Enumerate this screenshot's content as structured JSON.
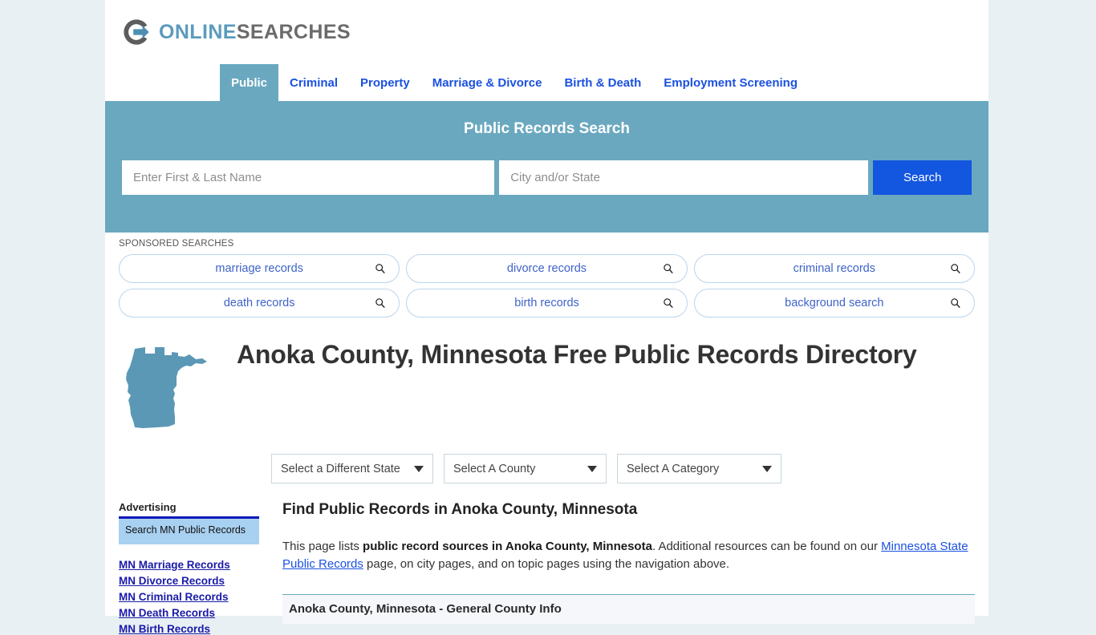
{
  "brand": {
    "name_part1": "ONLINE",
    "name_part2": "SEARCHES",
    "logo_icon": "circle-arrow-logo-icon"
  },
  "nav": {
    "tabs": [
      {
        "label": "Public",
        "active": true
      },
      {
        "label": "Criminal",
        "active": false
      },
      {
        "label": "Property",
        "active": false
      },
      {
        "label": "Marriage & Divorce",
        "active": false
      },
      {
        "label": "Birth & Death",
        "active": false
      },
      {
        "label": "Employment Screening",
        "active": false
      }
    ]
  },
  "hero": {
    "title": "Public Records Search",
    "name_placeholder": "Enter First & Last Name",
    "name_value": "",
    "city_placeholder": "City and/or State",
    "city_value": "",
    "submit_label": "Search",
    "background_color": "#6aa8c0",
    "submit_color": "#1356e0"
  },
  "sponsored": {
    "label": "SPONSORED SEARCHES",
    "rows": [
      [
        "marriage records",
        "divorce records",
        "criminal records"
      ],
      [
        "death records",
        "birth records",
        "background search"
      ]
    ],
    "icon": "magnifier-icon"
  },
  "title_block": {
    "state_map_icon": "minnesota-state-map-icon",
    "map_color": "#5b98b5",
    "heading": "Anoka County, Minnesota Free Public Records Directory"
  },
  "selectors": {
    "state": "Select a Different State",
    "county": "Select A County",
    "category": "Select A Category",
    "caret_icon": "chevron-down-icon"
  },
  "sidebar": {
    "advertising_label": "Advertising",
    "ad_text": "Search MN Public Records",
    "links": [
      "MN Marriage Records",
      "MN Divorce Records",
      "MN Criminal Records",
      "MN Death Records",
      "MN Birth Records"
    ]
  },
  "content": {
    "heading": "Find Public Records in Anoka County, Minnesota",
    "para_lead": "This page lists ",
    "para_bold": "public record sources in Anoka County, Minnesota",
    "para_mid": ". Additional resources can be found on our ",
    "para_link": "Minnesota State Public Records",
    "para_tail": " page, on city pages, and on topic pages using the navigation above.",
    "section_header": "Anoka County, Minnesota - General County Info"
  }
}
